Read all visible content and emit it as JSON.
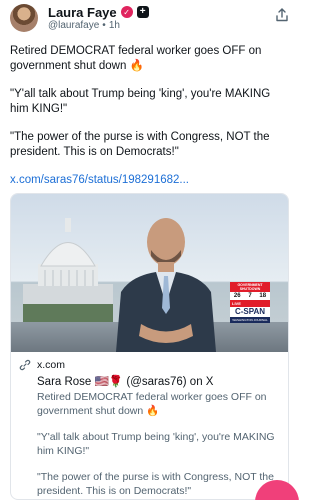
{
  "author": {
    "name": "Laura Faye",
    "handle": "@laurafaye",
    "separator": "•",
    "time": "1h",
    "verified_icon": "heart-check-icon",
    "plus_badge": "+"
  },
  "post": {
    "line1": "Retired DEMOCRAT federal worker goes OFF on government shut down 🔥",
    "line2": "\"Y'all talk about Trump being 'king', you're MAKING him KING!\"",
    "line3": "\"The power of the purse is with Congress, NOT the president. This is on Democrats!\"",
    "link": "x.com/saras76/status/198291682..."
  },
  "card": {
    "source": "x.com",
    "title": "Sara Rose 🇺🇸🌹 (@saras76) on X",
    "desc1": "Retired DEMOCRAT federal worker goes OFF on government shut down 🔥",
    "desc2": "\"Y'all talk about Trump being 'king', you're MAKING him KING!\"",
    "desc3": "\"The power of the purse is with Congress, NOT the president. This is on Democrats!\"",
    "thumb": {
      "panel_top": "GOVERNMENT SHUTDOWN",
      "n1": "26",
      "n2": "7",
      "n3": "18",
      "live": "LIVE",
      "brand": "C-SPAN",
      "brand_sub": "WASHINGTON JOURNAL"
    }
  },
  "colors": {
    "link": "#1d6fd6",
    "fab": "#f0407a",
    "cspan_red": "#e11d2a"
  }
}
